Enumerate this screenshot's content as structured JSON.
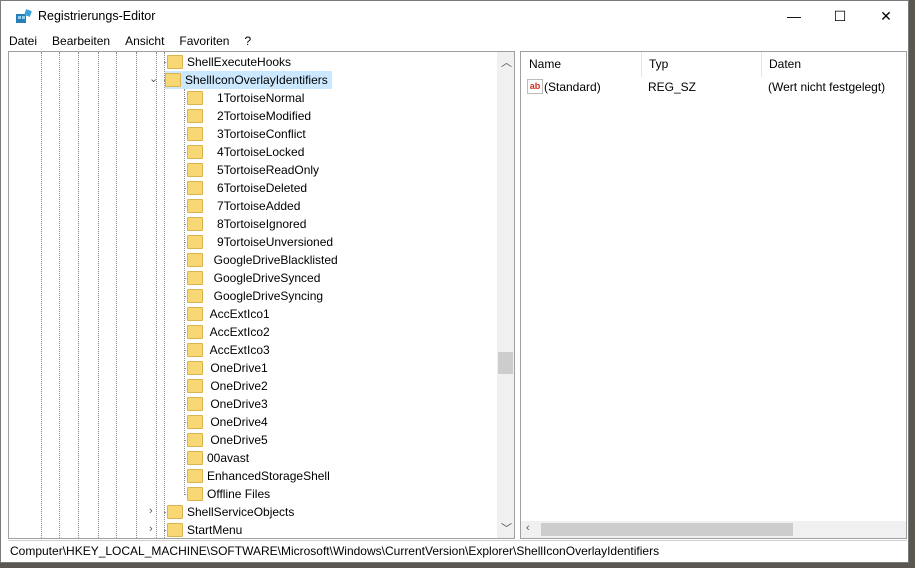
{
  "window": {
    "title": "Registrierungs-Editor",
    "minimize": "—",
    "maximize": "☐",
    "close": "✕"
  },
  "menu": [
    "Datei",
    "Bearbeiten",
    "Ansicht",
    "Favoriten",
    "?"
  ],
  "tree": {
    "top": "ShellExecuteHooks",
    "selected": "ShellIconOverlayIdentifiers",
    "children": [
      "   1TortoiseNormal",
      "   2TortoiseModified",
      "   3TortoiseConflict",
      "   4TortoiseLocked",
      "   5TortoiseReadOnly",
      "   6TortoiseDeleted",
      "   7TortoiseAdded",
      "   8TortoiseIgnored",
      "   9TortoiseUnversioned",
      "  GoogleDriveBlacklisted",
      "  GoogleDriveSynced",
      "  GoogleDriveSyncing",
      " AccExtIco1",
      " AccExtIco2",
      " AccExtIco3",
      " OneDrive1",
      " OneDrive2",
      " OneDrive3",
      " OneDrive4",
      " OneDrive5",
      "00avast",
      "EnhancedStorageShell",
      "Offline Files"
    ],
    "after": [
      "ShellServiceObjects",
      "StartMenu"
    ]
  },
  "list": {
    "headers": [
      "Name",
      "Typ",
      "Daten"
    ],
    "rows": [
      {
        "name": "(Standard)",
        "type": "REG_SZ",
        "data": "(Wert nicht festgelegt)",
        "icon": "ab"
      }
    ]
  },
  "status": "Computer\\HKEY_LOCAL_MACHINE\\SOFTWARE\\Microsoft\\Windows\\CurrentVersion\\Explorer\\ShellIconOverlayIdentifiers"
}
